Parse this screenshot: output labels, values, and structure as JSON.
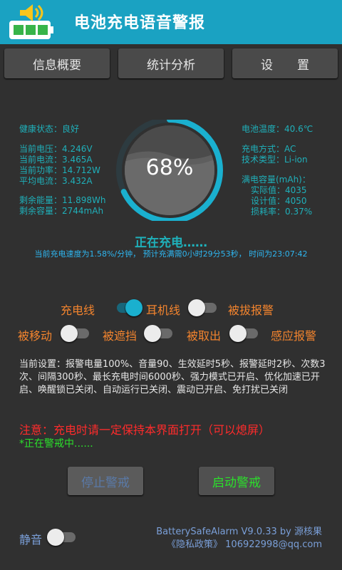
{
  "app": {
    "title": "电池充电语音警报"
  },
  "tabs": [
    "信息概要",
    "统计分析",
    "设　　置"
  ],
  "left_info": {
    "health": "健康状态：良好",
    "voltage": "当前电压：4.246V",
    "current": "当前电流：3.465A",
    "power": "当前功率：14.712W",
    "avg_current": "平均电流：3.432A",
    "remaining_energy": "剩余能量：11.898Wh",
    "remaining_capacity": "剩余容量：2744mAh"
  },
  "right_info": {
    "temperature": "电池温度：40.6℃",
    "charge_method": "充电方式：AC",
    "tech_type": "技术类型：Li-ion",
    "full_capacity": "满电容量(mAh)：",
    "actual": "实际值：4035",
    "design": "设计值：4050",
    "wear": "损耗率：0.37%"
  },
  "gauge": {
    "percent_text": "68%",
    "level": 0.68
  },
  "status": {
    "charging": "正在充电……",
    "speed": "当前充电速度为1.58%/分钟，  预计充满需0小时29分53秒，  时间为23:07:42"
  },
  "options": {
    "charge_line": "充电线",
    "headphone_line": "耳机线",
    "unplug_alarm": "被拔报警",
    "moved": "被移动",
    "covered": "被遮挡",
    "removed": "被取出",
    "sensor_alarm": "感应报警"
  },
  "toggles": {
    "charge_line": "on",
    "headphone_line": "off",
    "moved": "off",
    "covered": "off",
    "removed": "off",
    "mute": "off"
  },
  "settings_text": "当前设置：报警电量100%、音量90、生效延时5秒、报警延时2秒、次数3次、间隔300秒、最长充电时间6000秒、强力模式已开启、优化加速已开启、唤醒锁已关闭、自动运行已关闭、震动已开启、免打扰已关闭",
  "warning": "注意：充电时请一定保持本界面打开（可以熄屏）",
  "guard_status": "*正在警戒中......",
  "buttons": {
    "stop": "停止警戒",
    "start": "启动警戒"
  },
  "mute_label": "静音",
  "footer": {
    "version": "BatterySafeAlarm V9.0.33 by 源核果",
    "privacy": "《隐私政策》  106922998@qq.com"
  },
  "colors": {
    "header": "#1aa2c2",
    "accent": "#1fb0ba",
    "option": "#f3842e",
    "warning": "#ff2b2b",
    "guard": "#2be02b",
    "start_text": "#2be02b",
    "stop_text": "#5a7aa8"
  }
}
